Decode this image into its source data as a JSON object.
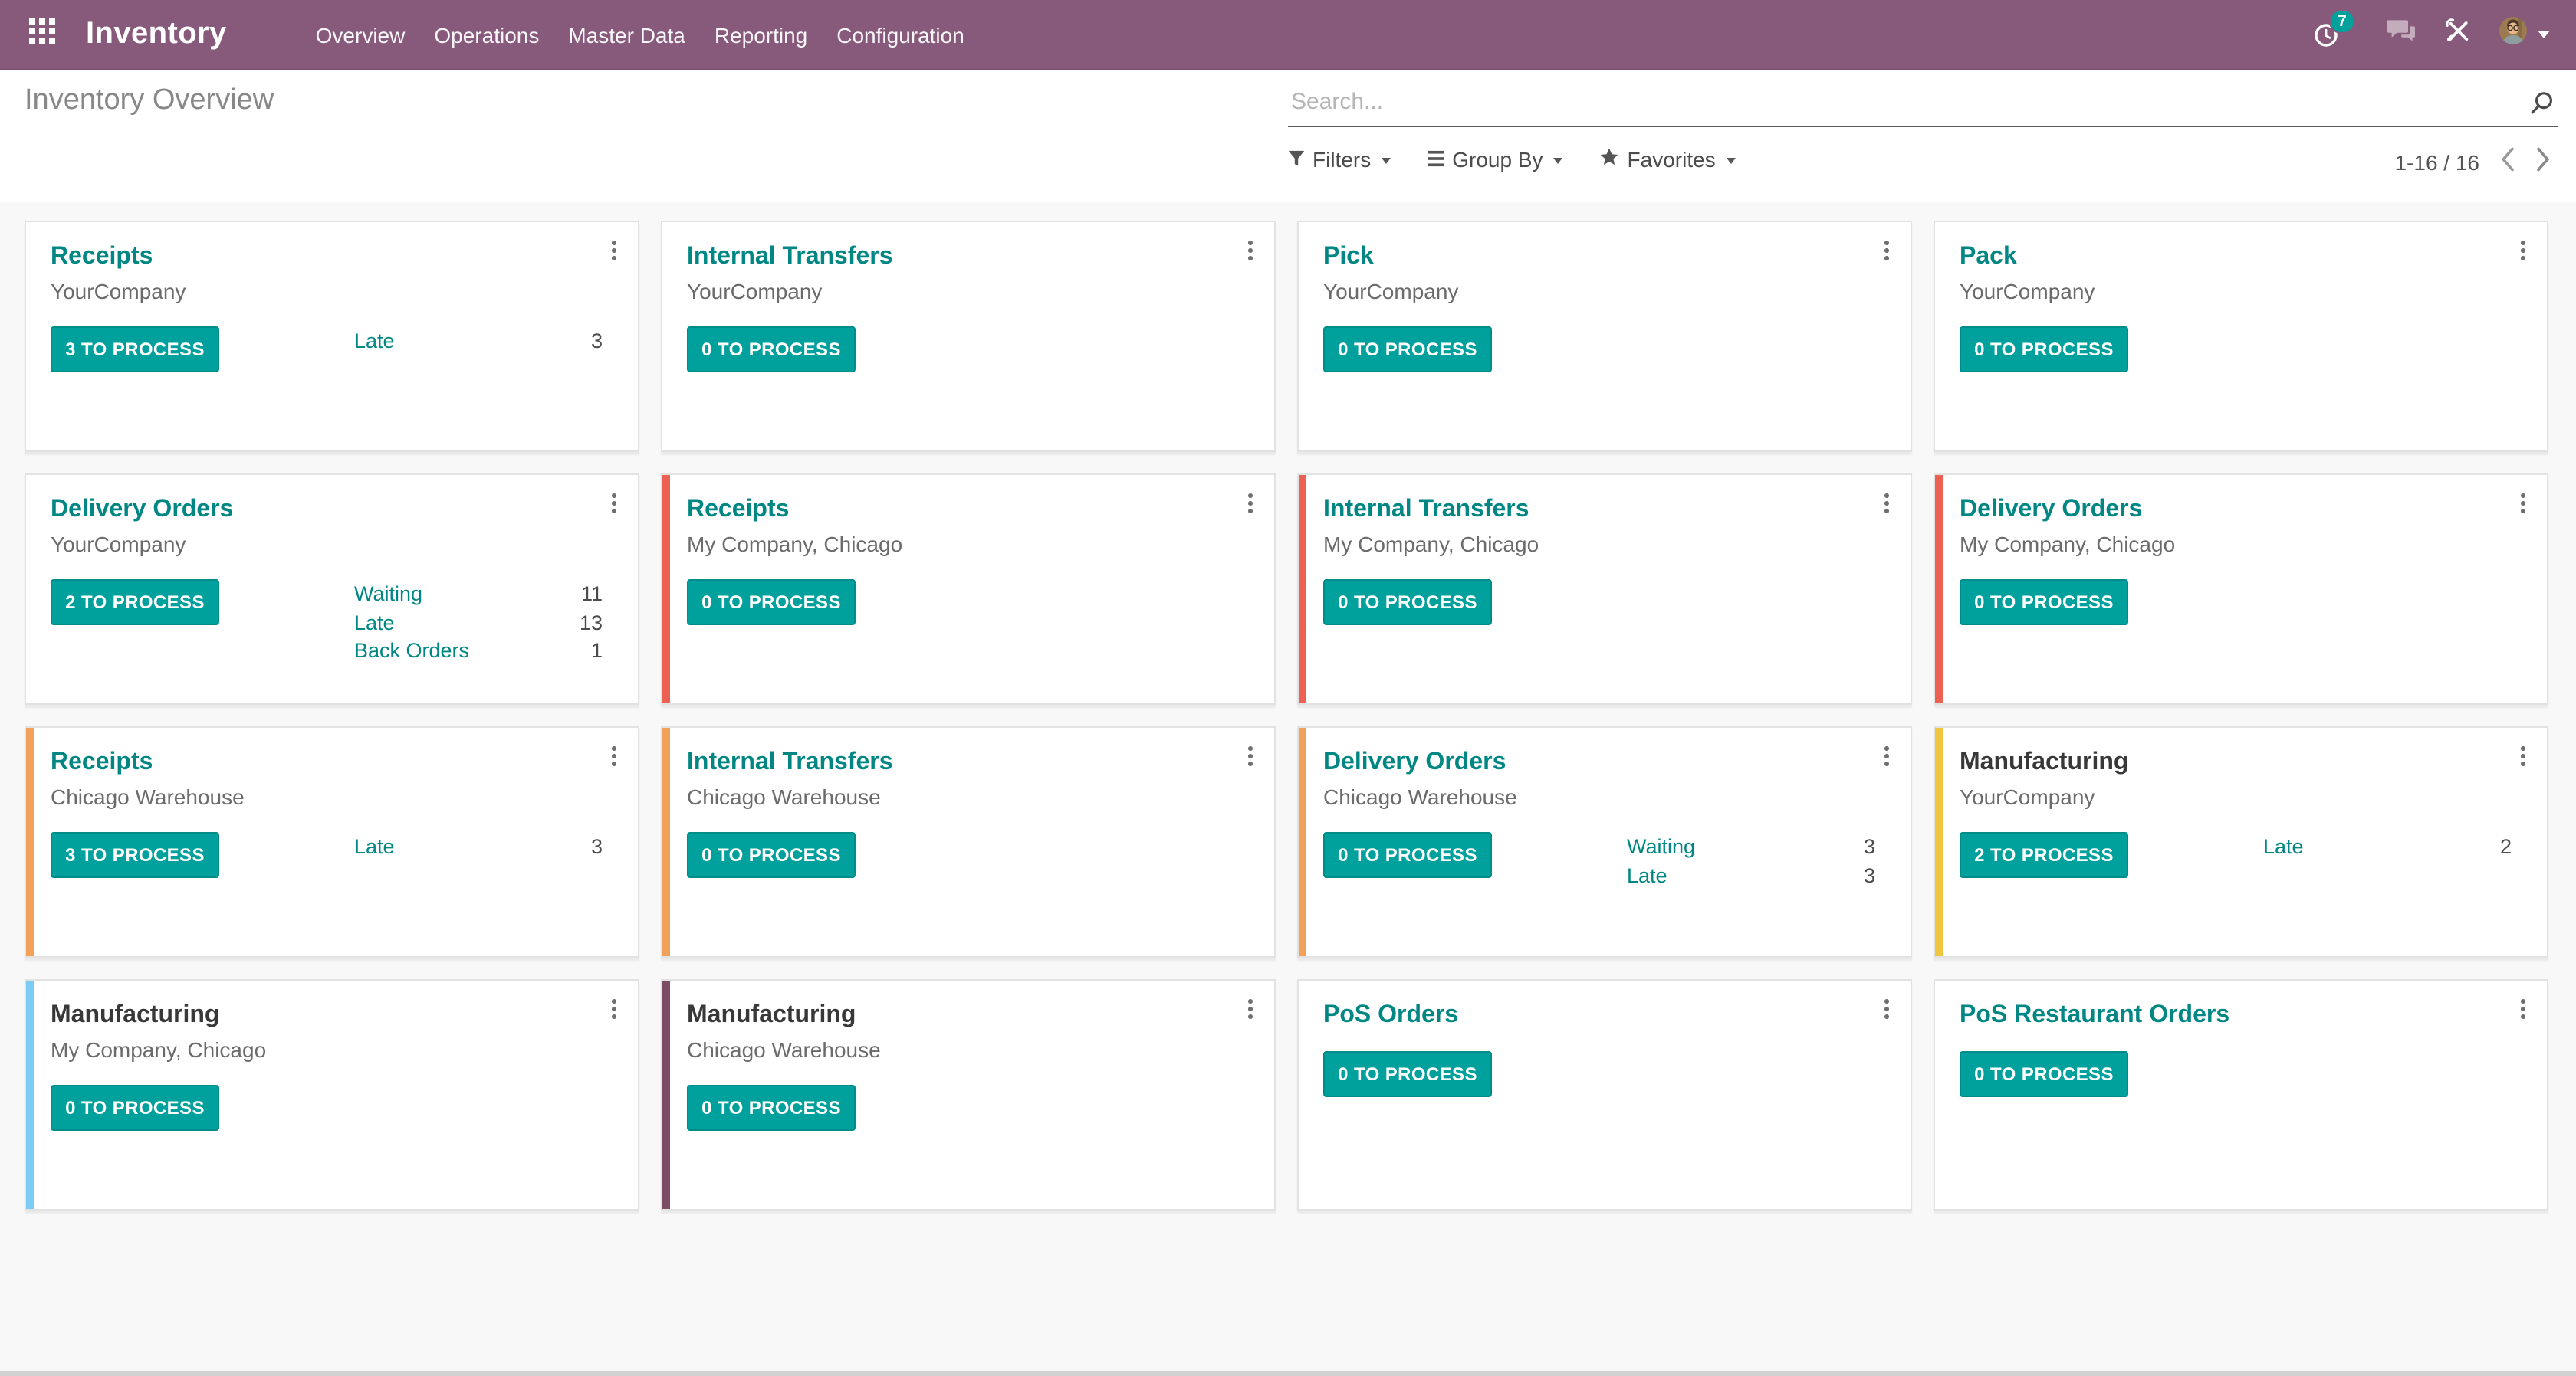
{
  "nav": {
    "app_title": "Inventory",
    "menu": [
      {
        "label": "Overview"
      },
      {
        "label": "Operations"
      },
      {
        "label": "Master Data"
      },
      {
        "label": "Reporting"
      },
      {
        "label": "Configuration"
      }
    ],
    "activity_count": "7",
    "icons": {
      "apps": "apps-grid-icon",
      "activities": "clock-icon",
      "messaging": "chat-bubbles-icon",
      "tools": "wrench-screwdriver-icon",
      "user": "avatar",
      "user_caret": "chevron-down-icon"
    }
  },
  "control_panel": {
    "title": "Inventory Overview",
    "search": {
      "placeholder": "Search...",
      "icon": "search-icon"
    },
    "filters": {
      "label": "Filters",
      "icon": "filter-funnel-icon"
    },
    "group_by": {
      "label": "Group By",
      "icon": "list-bars-icon"
    },
    "favorites": {
      "label": "Favorites",
      "icon": "star-icon"
    },
    "pager": {
      "range": "1-16 / 16",
      "prev_icon": "chevron-left-icon",
      "next_icon": "chevron-right-icon"
    }
  },
  "colors": {
    "nav_bg": "#875A7B",
    "accent_teal": "#00A09D",
    "link_teal": "#008784",
    "ribbon_red": "#ED6154",
    "ribbon_orange": "#F2A15A",
    "ribbon_yellow": "#EFC63F",
    "ribbon_blue": "#7DCCF3",
    "ribbon_purple": "#7C4D64"
  },
  "cards": [
    {
      "title": "Receipts",
      "subtitle": "YourCompany",
      "button": "3 TO PROCESS",
      "ribbon": null,
      "title_style": "teal",
      "stats": [
        {
          "label": "Late",
          "value": "3"
        }
      ]
    },
    {
      "title": "Internal Transfers",
      "subtitle": "YourCompany",
      "button": "0 TO PROCESS",
      "ribbon": null,
      "title_style": "teal",
      "stats": []
    },
    {
      "title": "Pick",
      "subtitle": "YourCompany",
      "button": "0 TO PROCESS",
      "ribbon": null,
      "title_style": "teal",
      "stats": []
    },
    {
      "title": "Pack",
      "subtitle": "YourCompany",
      "button": "0 TO PROCESS",
      "ribbon": null,
      "title_style": "teal",
      "stats": []
    },
    {
      "title": "Delivery Orders",
      "subtitle": "YourCompany",
      "button": "2 TO PROCESS",
      "ribbon": null,
      "title_style": "teal",
      "stats": [
        {
          "label": "Waiting",
          "value": "11"
        },
        {
          "label": "Late",
          "value": "13"
        },
        {
          "label": "Back Orders",
          "value": "1"
        }
      ]
    },
    {
      "title": "Receipts",
      "subtitle": "My Company, Chicago",
      "button": "0 TO PROCESS",
      "ribbon": "red",
      "title_style": "teal",
      "stats": []
    },
    {
      "title": "Internal Transfers",
      "subtitle": "My Company, Chicago",
      "button": "0 TO PROCESS",
      "ribbon": "red",
      "title_style": "teal",
      "stats": []
    },
    {
      "title": "Delivery Orders",
      "subtitle": "My Company, Chicago",
      "button": "0 TO PROCESS",
      "ribbon": "red",
      "title_style": "teal",
      "stats": []
    },
    {
      "title": "Receipts",
      "subtitle": "Chicago Warehouse",
      "button": "3 TO PROCESS",
      "ribbon": "orange",
      "title_style": "teal",
      "stats": [
        {
          "label": "Late",
          "value": "3"
        }
      ]
    },
    {
      "title": "Internal Transfers",
      "subtitle": "Chicago Warehouse",
      "button": "0 TO PROCESS",
      "ribbon": "orange",
      "title_style": "teal",
      "stats": []
    },
    {
      "title": "Delivery Orders",
      "subtitle": "Chicago Warehouse",
      "button": "0 TO PROCESS",
      "ribbon": "orange",
      "title_style": "teal",
      "stats": [
        {
          "label": "Waiting",
          "value": "3"
        },
        {
          "label": "Late",
          "value": "3"
        }
      ]
    },
    {
      "title": "Manufacturing",
      "subtitle": "YourCompany",
      "button": "2 TO PROCESS",
      "ribbon": "yellow",
      "title_style": "dark",
      "stats": [
        {
          "label": "Late",
          "value": "2"
        }
      ]
    },
    {
      "title": "Manufacturing",
      "subtitle": "My Company, Chicago",
      "button": "0 TO PROCESS",
      "ribbon": "blue",
      "title_style": "dark",
      "stats": []
    },
    {
      "title": "Manufacturing",
      "subtitle": "Chicago Warehouse",
      "button": "0 TO PROCESS",
      "ribbon": "purple",
      "title_style": "dark",
      "stats": []
    },
    {
      "title": "PoS Orders",
      "subtitle": "",
      "button": "0 TO PROCESS",
      "ribbon": null,
      "title_style": "teal",
      "stats": []
    },
    {
      "title": "PoS Restaurant Orders",
      "subtitle": "",
      "button": "0 TO PROCESS",
      "ribbon": null,
      "title_style": "teal",
      "stats": []
    }
  ]
}
